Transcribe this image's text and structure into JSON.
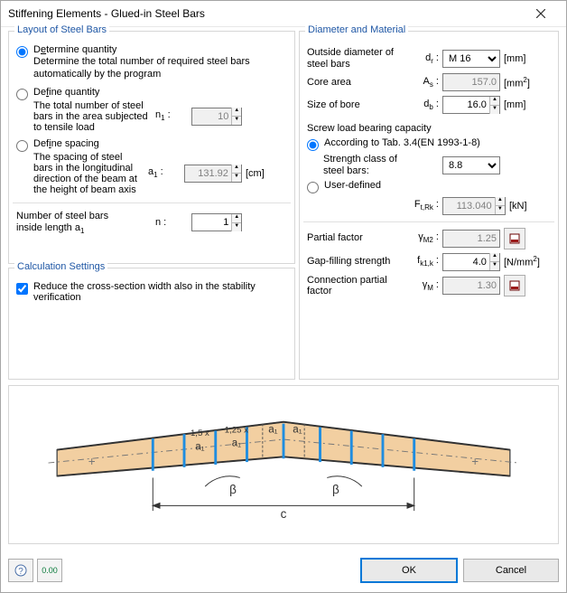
{
  "title": "Stiffening Elements - Glued-in Steel Bars",
  "layout": {
    "legend": "Layout of Steel Bars",
    "opt1": {
      "label_pre": "D",
      "label_ul": "e",
      "label_post": "termine quantity",
      "desc": "Determine the total number of required steel bars automatically by the program"
    },
    "opt2": {
      "label_pre": "De",
      "label_ul": "f",
      "label_post": "ine quantity",
      "desc": "The total number of steel bars in the area subjected to tensile load",
      "sym": "n",
      "sub": "1",
      "val": "10"
    },
    "opt3": {
      "label_pre": "Def",
      "label_ul": "i",
      "label_post": "ne spacing",
      "desc": "The spacing of steel bars in the longitudinal direction of the beam at the height of beam axis",
      "sym": "a",
      "sub": "1",
      "val": "131.92",
      "unit": "[cm]"
    },
    "nbars": {
      "label": "Number of steel bars",
      "label2": "inside length a",
      "sub": "1",
      "sym": "n :",
      "val": "1"
    }
  },
  "calc": {
    "legend": "Calculation Settings",
    "reduce": "Reduce the cross-section width also in the stability verification"
  },
  "diam": {
    "legend": "Diameter and Material",
    "outside": {
      "lbl": "Outside diameter of steel bars",
      "sym_html": "d<sub class='sub'>r</sub> :",
      "val": "M 16",
      "unit": "[mm]"
    },
    "corearea": {
      "lbl": "Core area",
      "sym_html": "A<sub class='sub'>s</sub> :",
      "val": "157.0",
      "unit_html": "[mm<sup class='sup'>2</sup>]"
    },
    "bore": {
      "lbl": "Size of bore",
      "sym_html": "d<sub class='sub'>b</sub> :",
      "val": "16.0",
      "unit": "[mm]"
    },
    "screw_heading": "Screw load bearing capacity",
    "accto": {
      "label_pre": "",
      "label_ul": "A",
      "label_post": "ccording to Tab. 3.4(EN 1993-1-8)"
    },
    "strength_class": {
      "lbl": "Strength class of steel bars:",
      "val": "8.8"
    },
    "user": {
      "label_pre": "",
      "label_ul": "U",
      "label_post": "ser-defined"
    },
    "ftrk": {
      "sym_html": "F<sub class='sub'>t,Rk</sub> :",
      "val": "113.040",
      "unit": "[kN]"
    },
    "partial": {
      "lbl": "Partial factor",
      "sym_html": "γ<sub class='sub'>M2</sub> :",
      "val": "1.25"
    },
    "gap": {
      "lbl": "Gap-filling strength",
      "sym_html": "f<sub class='sub'>k1,k</sub> :",
      "val": "4.0",
      "unit_html": "[N/mm<sup class='sup'>2</sup>]"
    },
    "conn": {
      "lbl": "Connection partial factor",
      "sym_html": "γ<sub class='sub'>M</sub> :",
      "val": "1.30"
    }
  },
  "diagram": {
    "labels": {
      "a1": "a₁",
      "m15": "1,5 x",
      "m125": "1,25 x",
      "beta": "β",
      "c": "c"
    }
  },
  "footer": {
    "ok": "OK",
    "cancel": "Cancel",
    "help_tip": "?",
    "units_tip": "0.00"
  }
}
